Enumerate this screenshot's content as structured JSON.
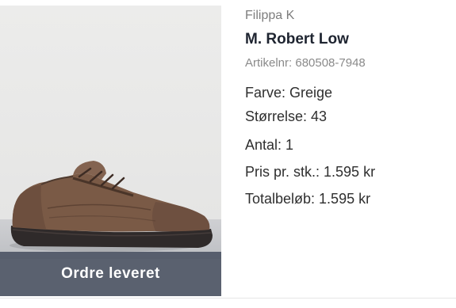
{
  "order_item": {
    "brand": "Filippa K",
    "product_name": "M. Robert Low",
    "article_number": "Artikelnr: 680508-7948",
    "color": "Farve: Greige",
    "size": "Størrelse: 43",
    "quantity": "Antal: 1",
    "unit_price": "Pris pr. stk.: 1.595 kr",
    "total": "Totalbeløb: 1.595 kr",
    "status": "Ordre leveret",
    "image_icon": "brown-suede-sneaker"
  },
  "colors": {
    "status_overlay": "#4e5665",
    "shoe_suede": "#7a5a46",
    "sole": "#2f2a2a",
    "title_text": "#1e2430"
  }
}
